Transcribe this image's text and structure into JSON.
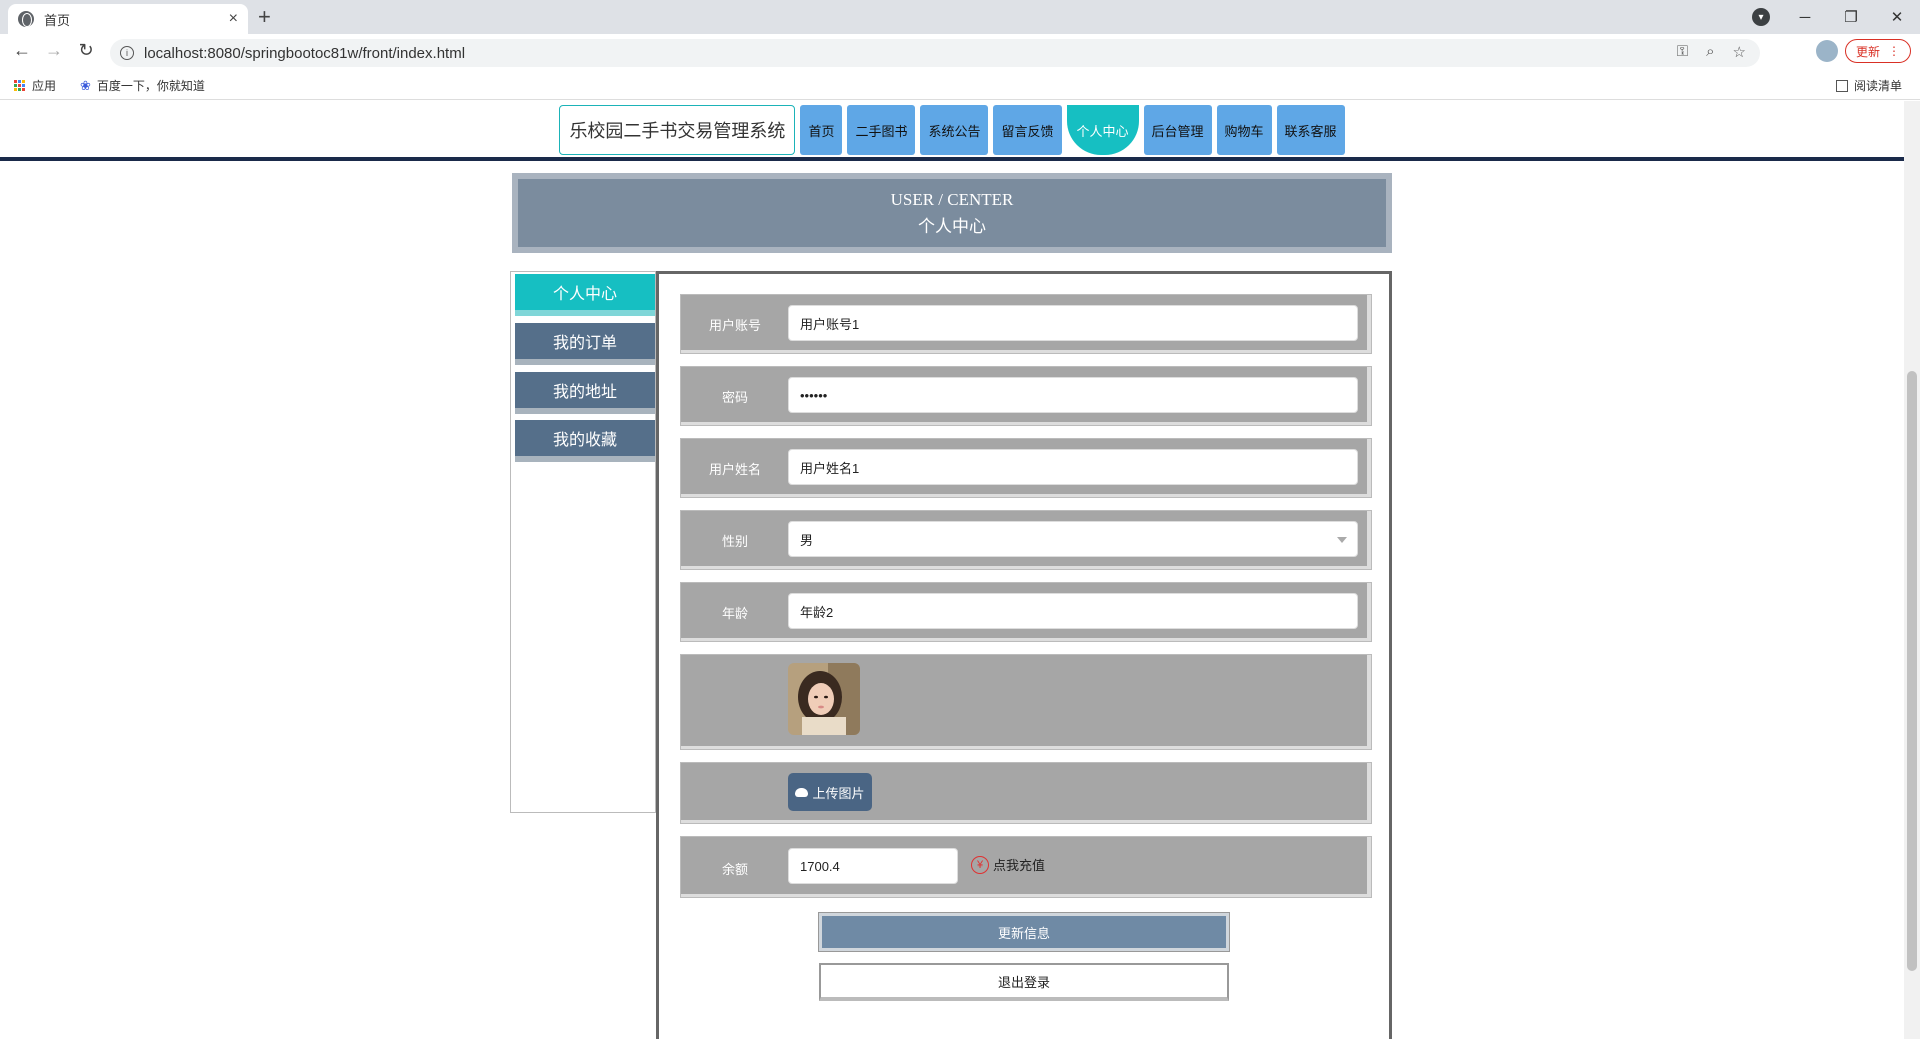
{
  "browser": {
    "tab_title": "首页",
    "tab_close": "×",
    "new_tab": "+",
    "url": "localhost:8080/springbootoc81w/front/index.html",
    "update_label": "更新",
    "bookmarks": [
      {
        "label": "应用",
        "icon": "apps-icon"
      },
      {
        "label": "百度一下，你就知道",
        "icon": "baidu-paw-icon"
      }
    ],
    "reading_list": "阅读清单"
  },
  "nav": {
    "site_title": "乐校园二手书交易管理系统",
    "items": [
      {
        "label": "首页",
        "active": false
      },
      {
        "label": "二手图书",
        "active": false
      },
      {
        "label": "系统公告",
        "active": false
      },
      {
        "label": "留言反馈",
        "active": false
      },
      {
        "label": "个人中心",
        "active": true
      },
      {
        "label": "后台管理",
        "active": false
      },
      {
        "label": "购物车",
        "active": false
      },
      {
        "label": "联系客服",
        "active": false
      }
    ]
  },
  "hero": {
    "title_en": "USER / CENTER",
    "title_cn": "个人中心"
  },
  "side_menu": {
    "items": [
      {
        "label": "个人中心",
        "active": true
      },
      {
        "label": "我的订单",
        "active": false
      },
      {
        "label": "我的地址",
        "active": false
      },
      {
        "label": "我的收藏",
        "active": false
      }
    ]
  },
  "form": {
    "username": {
      "label": "用户账号",
      "value": "用户账号1"
    },
    "password": {
      "label": "密码",
      "value": "••••••"
    },
    "realname": {
      "label": "用户姓名",
      "value": "用户姓名1"
    },
    "gender": {
      "label": "性别",
      "value": "男"
    },
    "age": {
      "label": "年龄",
      "value": "年龄2"
    },
    "upload_label": "上传图片",
    "balance": {
      "label": "余额",
      "value": "1700.4"
    },
    "recharge_label": "点我充值",
    "update_button": "更新信息",
    "logout_button": "退出登录"
  },
  "colors": {
    "accent_teal": "#16bfc2",
    "nav_blue": "#5fa7e6",
    "panel_slate": "#556f8a",
    "row_gray": "#a6a6a6"
  }
}
